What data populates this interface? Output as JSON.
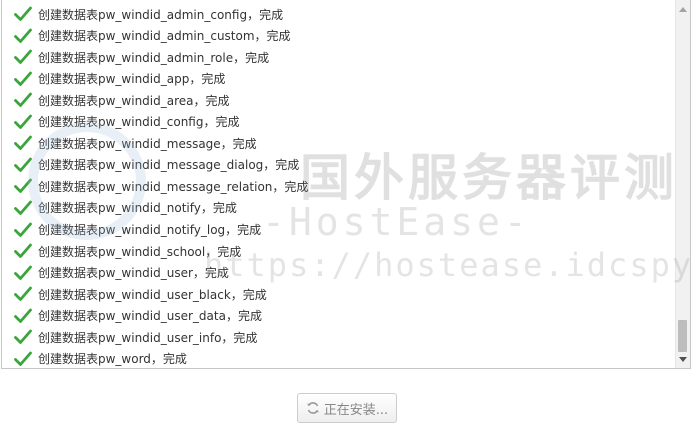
{
  "log": {
    "items": [
      "创建数据表pw_windid_admin_config，完成",
      "创建数据表pw_windid_admin_custom，完成",
      "创建数据表pw_windid_admin_role，完成",
      "创建数据表pw_windid_app，完成",
      "创建数据表pw_windid_area，完成",
      "创建数据表pw_windid_config，完成",
      "创建数据表pw_windid_message，完成",
      "创建数据表pw_windid_message_dialog，完成",
      "创建数据表pw_windid_message_relation，完成",
      "创建数据表pw_windid_notify，完成",
      "创建数据表pw_windid_notify_log，完成",
      "创建数据表pw_windid_school，完成",
      "创建数据表pw_windid_user，完成",
      "创建数据表pw_windid_user_black，完成",
      "创建数据表pw_windid_user_data，完成",
      "创建数据表pw_windid_user_info，完成",
      "创建数据表pw_word，完成"
    ],
    "status_icon": "check-icon",
    "status_color": "#3aa53a"
  },
  "watermark": {
    "title": "国外服务器评测",
    "subtitle": "-HostEase-",
    "url": "https://hostease.idcspy.com/"
  },
  "install_button": {
    "label": "正在安装...",
    "icon": "refresh-icon"
  }
}
